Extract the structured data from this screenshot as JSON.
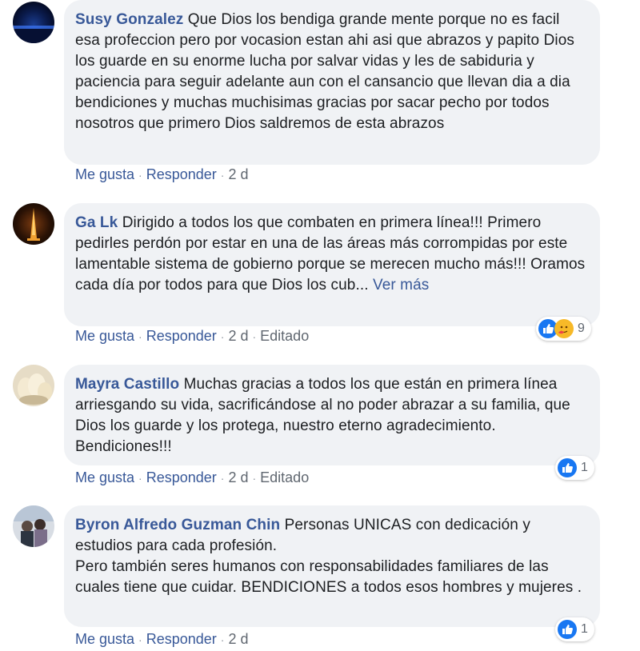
{
  "comments": [
    {
      "author": "Susy Gonzalez",
      "text": "Que Dios los bendiga grande mente porque no es facil esa profeccion pero por vocasion estan ahi asi que abrazos y papito Dios los guarde en su enorme lucha por salvar vidas y les de sabiduria y paciencia para seguir adelante aun con el cansancio que llevan dia a dia bendiciones y muchas muchisimas gracias por sacar pecho por todos nosotros que primero Dios saldremos de esta abrazos",
      "like_label": "Me gusta",
      "reply_label": "Responder",
      "time": "2 d"
    },
    {
      "author": "Ga Lk",
      "text": "Dirigido a todos los que combaten en primera línea!!! Primero pedirles perdón por estar en una de las áreas más corrompidas por este lamentable sistema de gobierno porque se merecen mucho más!!! Oramos cada día por todos para que Dios los cub...",
      "see_more": "Ver más",
      "like_label": "Me gusta",
      "reply_label": "Responder",
      "time": "2 d",
      "edited": "Editado",
      "reaction_count": "9",
      "reaction_icons": [
        "like-icon",
        "care-icon"
      ]
    },
    {
      "author": "Mayra Castillo",
      "text": "Muchas gracias a todos los que están en primera línea arriesgando su vida, sacrificándose al no poder abrazar a su familia, que Dios los guarde y los protega, nuestro eterno agradecimiento. Bendiciones!!!",
      "like_label": "Me gusta",
      "reply_label": "Responder",
      "time": "2 d",
      "edited": "Editado",
      "reaction_count": "1",
      "reaction_icons": [
        "like-icon"
      ]
    },
    {
      "author": "Byron Alfredo Guzman Chin",
      "text_lines": [
        "Personas UNICAS con dedicación y estudios para cada profesión.",
        "Pero también seres humanos con responsabilidades familiares de las cuales tiene que cuidar. BENDICIONES a todos esos hombres y mujeres ."
      ],
      "like_label": "Me gusta",
      "reply_label": "Responder",
      "time": "2 d",
      "reaction_count": "1",
      "reaction_icons": [
        "like-icon"
      ]
    }
  ],
  "colors": {
    "link": "#385898",
    "bubble": "#f0f2f5",
    "meta": "#606770",
    "like_blue": "#1877f2",
    "care_yellow": "#f7b928"
  }
}
